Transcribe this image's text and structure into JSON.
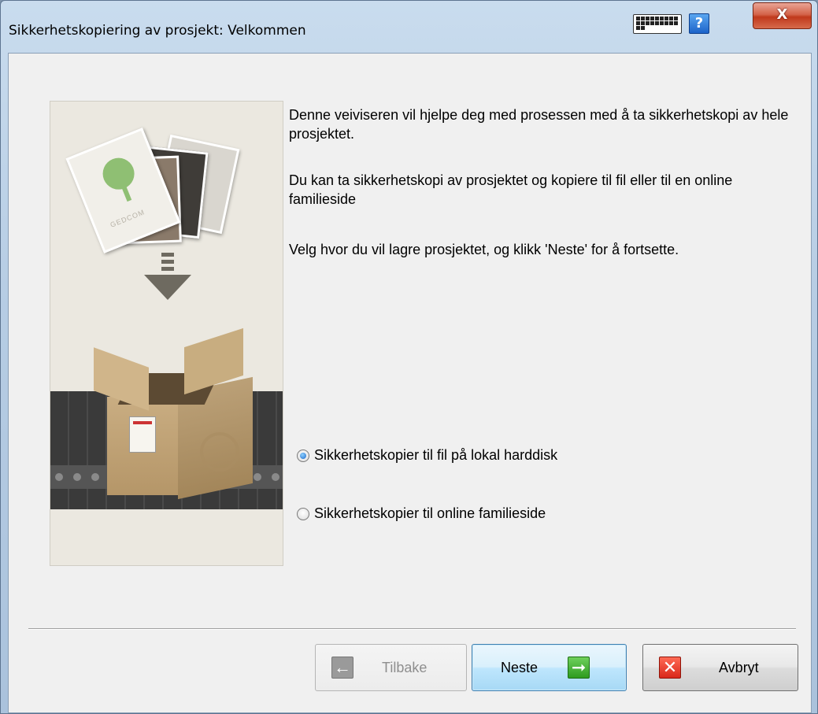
{
  "window": {
    "title": "Sikkerhetskopiering av prosjekt: Velkommen",
    "close_label": "X",
    "help_label": "?"
  },
  "illustration": {
    "card_text": "GEDCOM"
  },
  "intro": {
    "paragraph1": "Denne veiviseren vil hjelpe deg med prosessen med å ta sikkerhetskopi av hele prosjektet.",
    "paragraph2": "Du kan ta sikkerhetskopi av prosjektet og kopiere til fil eller til en online familieside",
    "paragraph3": "Velg hvor du vil lagre prosjektet, og klikk 'Neste' for å fortsette."
  },
  "options": {
    "local": {
      "label": "Sikkerhetskopier til fil på lokal harddisk",
      "checked": true
    },
    "online": {
      "label": "Sikkerhetskopier til online familieside",
      "checked": false
    }
  },
  "buttons": {
    "back": "Tilbake",
    "next": "Neste",
    "cancel": "Avbryt"
  },
  "colors": {
    "accent": "#3c7fb1",
    "next_icon": "#2e9b1f",
    "cancel_icon": "#d9271a"
  }
}
